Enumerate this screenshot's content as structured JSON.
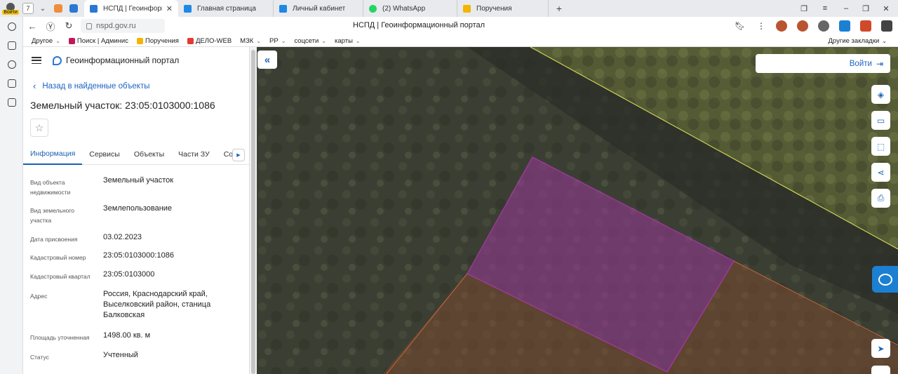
{
  "browser": {
    "profile_badge": "Войти",
    "tab_count": "7",
    "tabs": [
      {
        "title": "НСПД | Геоинформаци",
        "active": true,
        "color": "#2a78d4"
      },
      {
        "title": "Главная страница",
        "active": false,
        "color": "#1e88e5"
      },
      {
        "title": "Личный кабинет",
        "active": false,
        "color": "#1e88e5"
      },
      {
        "title": "(2) WhatsApp",
        "active": false,
        "color": "#25d366"
      },
      {
        "title": "Поручения",
        "active": false,
        "color": "#f4b400"
      }
    ],
    "url": "nspd.gov.ru",
    "page_title": "НСПД | Геоинформационный портал",
    "bookmarks": [
      {
        "label": "Другое",
        "dropdown": true,
        "color": ""
      },
      {
        "label": "Поиск | Админис",
        "dropdown": false,
        "color": "#c2185b"
      },
      {
        "label": "Поручения",
        "dropdown": false,
        "color": "#f4b400"
      },
      {
        "label": "ДЕЛО-WEB",
        "dropdown": false,
        "color": "#e53935"
      },
      {
        "label": "МЗК",
        "dropdown": true,
        "color": ""
      },
      {
        "label": "РР",
        "dropdown": true,
        "color": ""
      },
      {
        "label": "соцсети",
        "dropdown": true,
        "color": ""
      },
      {
        "label": "карты",
        "dropdown": true,
        "color": ""
      }
    ],
    "other_bookmarks": "Другие закладки"
  },
  "app": {
    "title": "Геоинформационный портал",
    "back_link": "Назад в найденные объекты",
    "object_title": "Земельный участок: 23:05:0103000:1086",
    "tabs": [
      "Информация",
      "Сервисы",
      "Объекты",
      "Части ЗУ",
      "Соста"
    ],
    "active_tab": "Информация",
    "properties": [
      {
        "label": "Вид объекта недвижимости",
        "value": "Земельный участок"
      },
      {
        "label": "Вид земельного участка",
        "value": "Землепользование"
      },
      {
        "label": "Дата присвоения",
        "value": "03.02.2023"
      },
      {
        "label": "Кадастровый номер",
        "value": "23:05:0103000:1086"
      },
      {
        "label": "Кадастровый квартал",
        "value": "23:05:0103000"
      },
      {
        "label": "Адрес",
        "value": "Россия, Краснодарский край, Выселковский район, станица Балковская"
      },
      {
        "label": "Площадь уточненная",
        "value": "1498.00 кв. м"
      },
      {
        "label": "Статус",
        "value": "Учтенный"
      }
    ]
  },
  "map": {
    "login_label": "Войти",
    "tools": [
      "layers-icon",
      "ruler-icon",
      "select-area-icon",
      "share-icon",
      "print-icon"
    ],
    "colors": {
      "parcel_selected": "#c838c8",
      "parcel_neighbor": "#c8643c",
      "border_line": "#e6e65a",
      "accent": "#1c64c0"
    }
  }
}
